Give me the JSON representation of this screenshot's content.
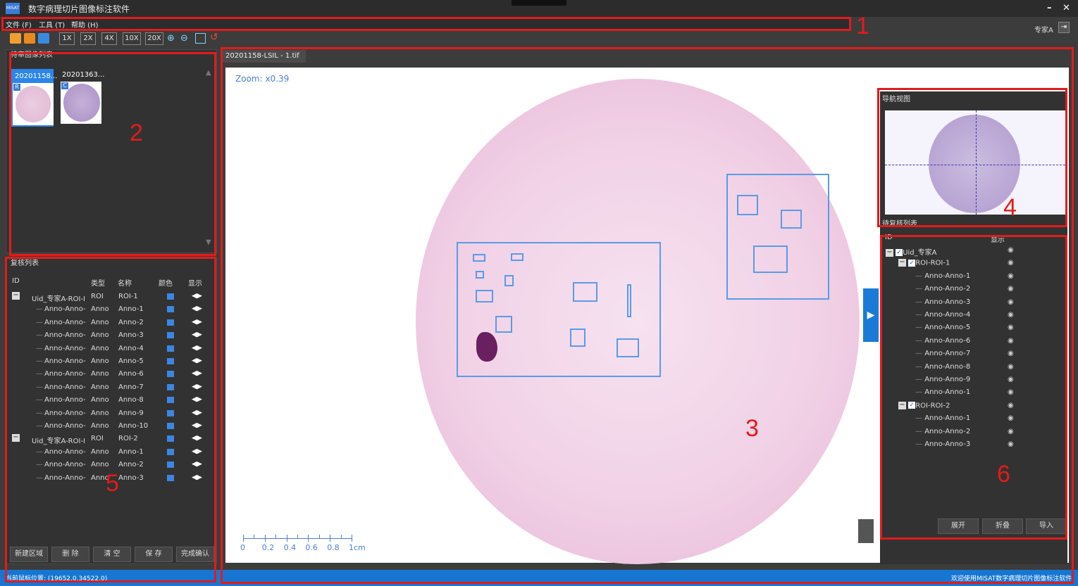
{
  "window": {
    "title": "数字病理切片图像标注软件",
    "logo_text": "MISAT",
    "minimize": "–",
    "close": "✕"
  },
  "menu": [
    {
      "label": "文件 (F)"
    },
    {
      "label": "工具 (T)"
    },
    {
      "label": "帮助 (H)"
    }
  ],
  "user": {
    "name": "专家A"
  },
  "toolbar": {
    "zoom_buttons": [
      "1X",
      "2X",
      "4X",
      "10X",
      "20X"
    ]
  },
  "thumbs": {
    "panel_title": "待审图像列表",
    "items": [
      {
        "title": "20201158...",
        "tag": "R",
        "selected": true
      },
      {
        "title": "20201363...",
        "tag": "C",
        "selected": false
      }
    ]
  },
  "review": {
    "title": "复核列表",
    "columns": [
      "ID",
      "类型",
      "名称",
      "颜色",
      "显示"
    ],
    "rows": [
      {
        "id": "Uid_专家A-ROI-I",
        "type": "ROI",
        "name": "ROI-1",
        "parent": true
      },
      {
        "id": "Anno-Anno-",
        "type": "Anno",
        "name": "Anno-1"
      },
      {
        "id": "Anno-Anno-",
        "type": "Anno",
        "name": "Anno-2"
      },
      {
        "id": "Anno-Anno-",
        "type": "Anno",
        "name": "Anno-3"
      },
      {
        "id": "Anno-Anno-",
        "type": "Anno",
        "name": "Anno-4"
      },
      {
        "id": "Anno-Anno-",
        "type": "Anno",
        "name": "Anno-5"
      },
      {
        "id": "Anno-Anno-",
        "type": "Anno",
        "name": "Anno-6"
      },
      {
        "id": "Anno-Anno-",
        "type": "Anno",
        "name": "Anno-7"
      },
      {
        "id": "Anno-Anno-",
        "type": "Anno",
        "name": "Anno-8"
      },
      {
        "id": "Anno-Anno-",
        "type": "Anno",
        "name": "Anno-9"
      },
      {
        "id": "Anno-Anno-",
        "type": "Anno",
        "name": "Anno-10"
      },
      {
        "id": "Uid_专家A-ROI-I",
        "type": "ROI",
        "name": "ROI-2",
        "parent": true
      },
      {
        "id": "Anno-Anno-",
        "type": "Anno",
        "name": "Anno-1"
      },
      {
        "id": "Anno-Anno-",
        "type": "Anno",
        "name": "Anno-2"
      },
      {
        "id": "Anno-Anno-",
        "type": "Anno",
        "name": "Anno-3"
      }
    ],
    "buttons": [
      "新建区域",
      "删 除",
      "清 空",
      "保 存",
      "完成确认"
    ],
    "eye_glyph": "◂●▸",
    "color": "#3d86e0"
  },
  "viewer": {
    "tab_title": "20201158-LSIL - 1.tif",
    "zoom": "Zoom: x0.39",
    "scale_labels": [
      "0",
      "0.2",
      "0.4",
      "0.6",
      "0.8",
      "1cm"
    ]
  },
  "nav": {
    "title": "导航视图"
  },
  "pending": {
    "title": "待复核列表",
    "columns": [
      "ID",
      "显示"
    ],
    "rows": [
      {
        "label": "Uid_专家A",
        "level": 0,
        "expand": "−",
        "check": true
      },
      {
        "label": "ROI-ROI-1",
        "level": 1,
        "expand": "−",
        "check": true
      },
      {
        "label": "Anno-Anno-1",
        "level": 2
      },
      {
        "label": "Anno-Anno-2",
        "level": 2
      },
      {
        "label": "Anno-Anno-3",
        "level": 2
      },
      {
        "label": "Anno-Anno-4",
        "level": 2
      },
      {
        "label": "Anno-Anno-5",
        "level": 2
      },
      {
        "label": "Anno-Anno-6",
        "level": 2
      },
      {
        "label": "Anno-Anno-7",
        "level": 2
      },
      {
        "label": "Anno-Anno-8",
        "level": 2
      },
      {
        "label": "Anno-Anno-9",
        "level": 2
      },
      {
        "label": "Anno-Anno-1",
        "level": 2
      },
      {
        "label": "ROI-ROI-2",
        "level": 1,
        "expand": "−",
        "check": true
      },
      {
        "label": "Anno-Anno-1",
        "level": 2
      },
      {
        "label": "Anno-Anno-2",
        "level": 2
      },
      {
        "label": "Anno-Anno-3",
        "level": 2
      }
    ],
    "buttons": [
      "展开",
      "折叠",
      "导入"
    ]
  },
  "status": {
    "left": "当前鼠标位置: (19652.0,34522.0)",
    "right": "欢迎使用MISAT数字病理切片图像标注软件"
  },
  "markers": [
    "1",
    "2",
    "3",
    "4",
    "5",
    "6"
  ],
  "colors": {
    "accent": "#1676d2",
    "roi_blue": "#5b9be6",
    "marker_red": "#e21b1b"
  }
}
